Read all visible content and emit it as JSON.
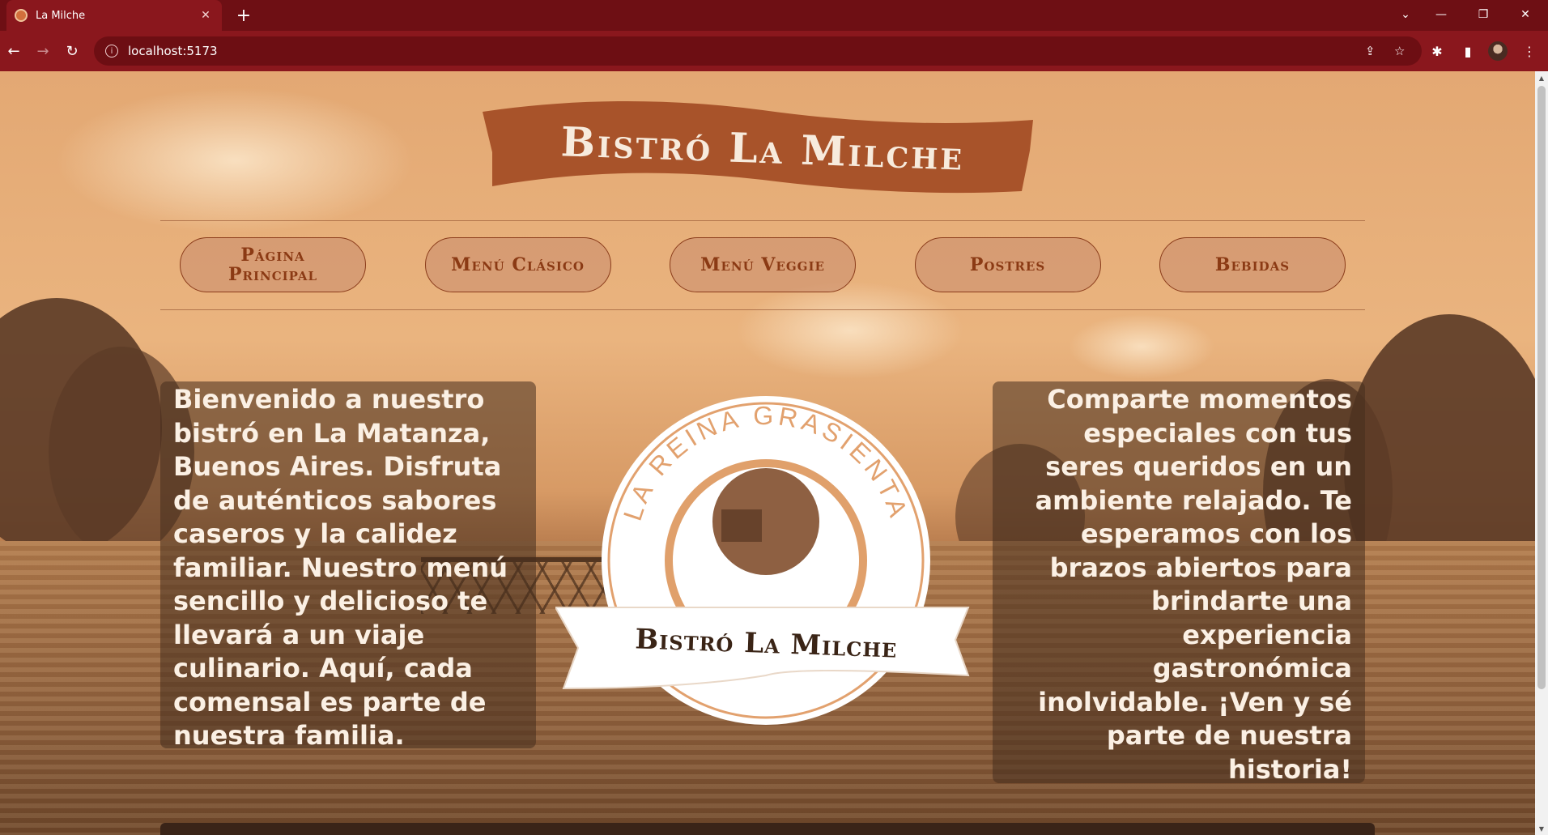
{
  "browser": {
    "tab_title": "La Milche",
    "tab_close": "✕",
    "new_tab": "+",
    "url": "localhost:5173",
    "window_controls": {
      "dropdown": "⌄",
      "minimize": "—",
      "restore": "❐",
      "close": "✕"
    },
    "nav": {
      "back": "←",
      "forward": "→",
      "reload": "↻"
    },
    "icons": {
      "share": "⇪",
      "bookmark": "☆",
      "extensions": "✱",
      "sidepanel": "▮",
      "menu": "⋮"
    },
    "accent_color": "#8a171d"
  },
  "page": {
    "banner_title": "Bistró La Milche",
    "nav_items": [
      {
        "label": "Página\nPrincipal"
      },
      {
        "label": "Menú Clásico"
      },
      {
        "label": "Menú Veggie"
      },
      {
        "label": "Postres"
      },
      {
        "label": "Bebidas"
      }
    ],
    "intro_left": "Bienvenido a nuestro bistró en La Matanza, Buenos Aires. Disfruta de auténticos sabores caseros y la calidez familiar. Nuestro menú sencillo y delicioso te llevará a un viaje culinario. Aquí, cada comensal es parte de nuestra familia.",
    "intro_right": "Comparte momentos especiales con tus seres queridos en un ambiente relajado. Te esperamos con los brazos abiertos para brindarte una experiencia gastronómica inolvidable. ¡Ven y sé parte de nuestra historia!",
    "logo": {
      "ring_text": "LA REINA GRASIENTA",
      "ribbon_text": "Bistró La Milche"
    },
    "colors": {
      "banner": "#a8532a",
      "nav_text": "#8b3a14",
      "background_tone": "#e3a873"
    }
  }
}
